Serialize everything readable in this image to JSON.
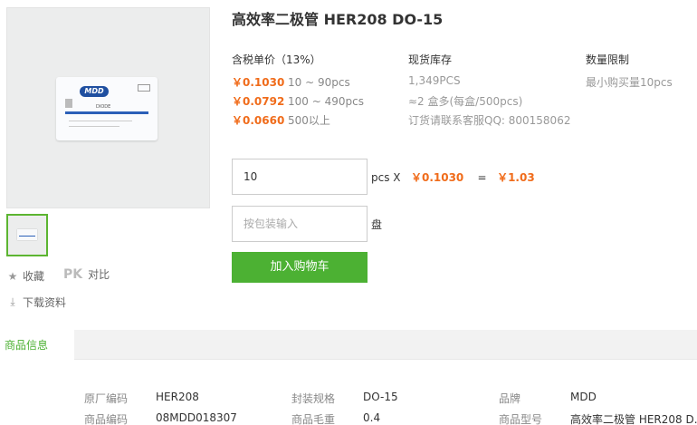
{
  "product": {
    "title": "高效率二极管 HER208 DO-15",
    "image_alt": "MDD DIODE package bag",
    "logo_text": "MDD",
    "bag_label": "DIODE"
  },
  "side": {
    "favorite_label": "收藏",
    "pk_label": "PK",
    "compare_label": "对比",
    "download_label": "下载资料"
  },
  "pricing": {
    "price_header": "含税单价（13%）",
    "stock_header": "现货库存",
    "limit_header": "数量限制",
    "tiers": [
      {
        "price": "￥0.1030",
        "range": "10 ~ 90pcs"
      },
      {
        "price": "￥0.0792",
        "range": "100 ~ 490pcs"
      },
      {
        "price": "￥0.0660",
        "range": "500以上"
      }
    ],
    "stock_qty": "1,349PCS",
    "stock_boxes": "≈2 盒多(每盒/500pcs)",
    "stock_contact": "订货请联系客服QQ: 800158062",
    "min_qty": "最小购买量10pcs"
  },
  "order": {
    "qty_value": "10",
    "pcs_x": "pcs X",
    "unit_price": "￥0.1030",
    "equals": "=",
    "total": "￥1.03",
    "pack_placeholder": "按包装输入",
    "pack_unit": "盘",
    "add_to_cart": "加入购物车"
  },
  "tabs": {
    "info": "商品信息"
  },
  "specs": [
    {
      "key": "原厂编码",
      "value": "HER208"
    },
    {
      "key": "封装规格",
      "value": "DO-15"
    },
    {
      "key": "品牌",
      "value": "MDD"
    },
    {
      "key": "商品编码",
      "value": "08MDD018307"
    },
    {
      "key": "商品毛重",
      "value": "0.4"
    },
    {
      "key": "商品型号",
      "value": "高效率二极管 HER208 D..."
    }
  ],
  "colors": {
    "accent_green": "#4cb133",
    "price_orange": "#f06c1b"
  }
}
